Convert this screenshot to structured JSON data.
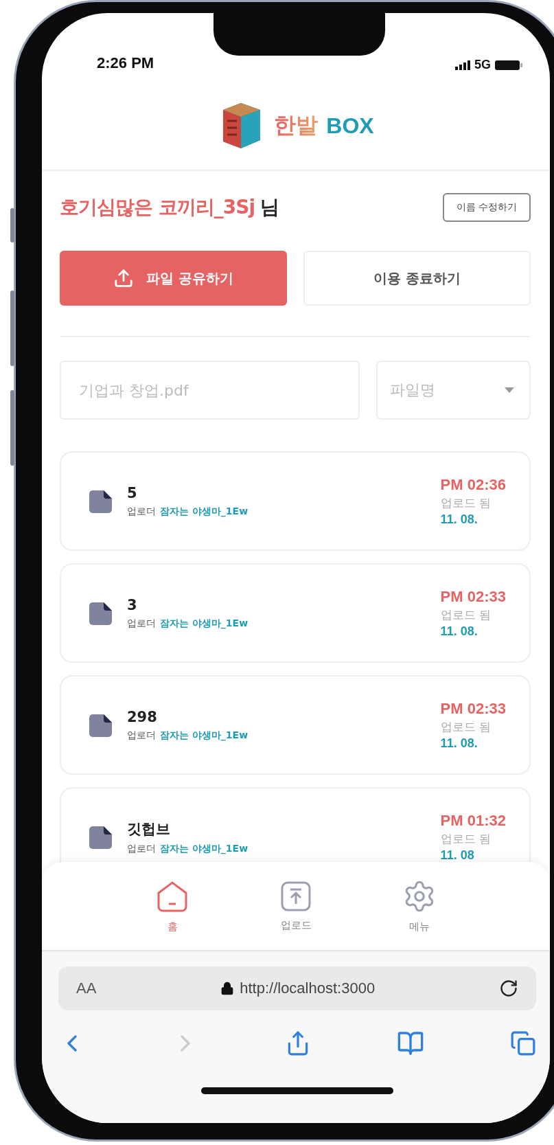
{
  "status_bar": {
    "time": "2:26 PM",
    "network": "5G"
  },
  "header": {
    "brand_first": "한발",
    "brand_second": "BOX"
  },
  "user": {
    "name": "호기심많은 코끼리_3Sj",
    "suffix": "님",
    "edit_button": "이름 수정하기"
  },
  "actions": {
    "share_button": "파일 공유하기",
    "quit_button": "이용 종료하기"
  },
  "search": {
    "placeholder": "기업과 창업.pdf",
    "sort_select": "파일명"
  },
  "files": [
    {
      "name": "5",
      "uploader_label": "업로더",
      "uploader": "잠자는 야생마_1Ew",
      "time": "PM 02:36",
      "status": "업로드 됨",
      "date": "11. 08."
    },
    {
      "name": "3",
      "uploader_label": "업로더",
      "uploader": "잠자는 야생마_1Ew",
      "time": "PM 02:33",
      "status": "업로드 됨",
      "date": "11. 08."
    },
    {
      "name": "298",
      "uploader_label": "업로더",
      "uploader": "잠자는 야생마_1Ew",
      "time": "PM 02:33",
      "status": "업로드 됨",
      "date": "11. 08."
    },
    {
      "name": "깃헙브",
      "uploader_label": "업로더",
      "uploader": "잠자는 야생마_1Ew",
      "time": "PM 01:32",
      "status": "업로드 됨",
      "date": "11. 08"
    }
  ],
  "tabs": [
    {
      "kind": "home",
      "label": "홈",
      "selected": true
    },
    {
      "kind": "upload",
      "label": "업로드",
      "selected": false
    },
    {
      "kind": "menu",
      "label": "메뉴",
      "selected": false
    }
  ],
  "browser": {
    "text_size": "AA",
    "url": "http://localhost:3000"
  }
}
